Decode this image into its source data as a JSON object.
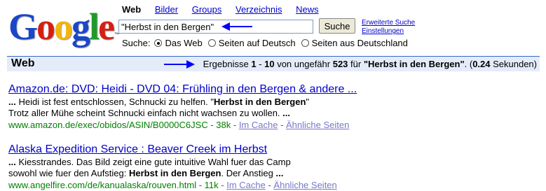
{
  "logo": {
    "letters": [
      {
        "char": "G",
        "color": "#1a46c8"
      },
      {
        "char": "o",
        "color": "#d51f13"
      },
      {
        "char": "o",
        "color": "#f2b50f"
      },
      {
        "char": "g",
        "color": "#1a46c8"
      },
      {
        "char": "l",
        "color": "#1f9a2a"
      },
      {
        "char": "e",
        "color": "#d51f13"
      }
    ],
    "tm": "™"
  },
  "tabs": [
    {
      "label": "Web",
      "active": true
    },
    {
      "label": "Bilder",
      "active": false
    },
    {
      "label": "Groups",
      "active": false
    },
    {
      "label": "Verzeichnis",
      "active": false
    },
    {
      "label": "News",
      "active": false
    }
  ],
  "search": {
    "value": "\"Herbst in den Bergen\"",
    "button_label": "Suche",
    "advanced_link": "Erweiterte Suche",
    "settings_link": "Einstellungen"
  },
  "scope": {
    "label": "Suche:",
    "options": [
      {
        "label": "Das Web",
        "checked": true
      },
      {
        "label": "Seiten auf Deutsch",
        "checked": false
      },
      {
        "label": "Seiten aus Deutschland",
        "checked": false
      }
    ]
  },
  "result_bar": {
    "label": "Web",
    "stats_prefix": "Ergebnisse ",
    "range_start": "1",
    "range_dash": " - ",
    "range_end": "10",
    "about_text": " von ungefähr ",
    "count": "523",
    "for_text": " für ",
    "query": "\"Herbst in den Bergen\"",
    "time_prefix": ". (",
    "time": "0.24",
    "time_suffix": " Sekunden)"
  },
  "results": [
    {
      "title": "Amazon.de: DVD: Heidi - DVD 04: Frühling in den Bergen & andere ...",
      "line1_a": "... ",
      "line1_bold_a": "",
      "line1_b": "Heidi ist fest entschlossen, Schnucki zu helfen. \"",
      "line1_bold_b": "Herbst in den Bergen",
      "line1_c": "\"",
      "line2_a": "Trotz aller Mühe scheint Schnucki einfach nicht wachsen zu wollen. ",
      "line2_bold": "...",
      "url": "www.amazon.de/exec/obidos/ASIN/B0000C6JSC",
      "size": "38k",
      "cache_label": "Im Cache",
      "similar_label": "Ähnliche Seiten",
      "sep": " - "
    },
    {
      "title": "Alaska Expedition Service : Beaver Creek im Herbst",
      "line1_a": "... ",
      "line1_b": "Kiesstrandes. Das Bild zeigt eine gute intuitive Wahl fuer das Camp",
      "line2_a": "sowohl wie fuer den Aufstieg: ",
      "line2_bold_a": "Herbst in den Bergen",
      "line2_b": ". Der Anstieg ",
      "line2_bold_b": "...",
      "url": "www.angelfire.com/de/kanualaska/rouven.html",
      "size": "11k",
      "cache_label": "Im Cache",
      "similar_label": "Ähnliche Seiten",
      "sep": " - "
    }
  ],
  "colors": {
    "link": "#0000cc",
    "url_green": "#008000",
    "bar_background": "#e5ecf9",
    "arrow_blue": "#0000ff"
  },
  "icons": [
    "arrow-left-icon",
    "arrow-right-icon",
    "radio-icon"
  ]
}
